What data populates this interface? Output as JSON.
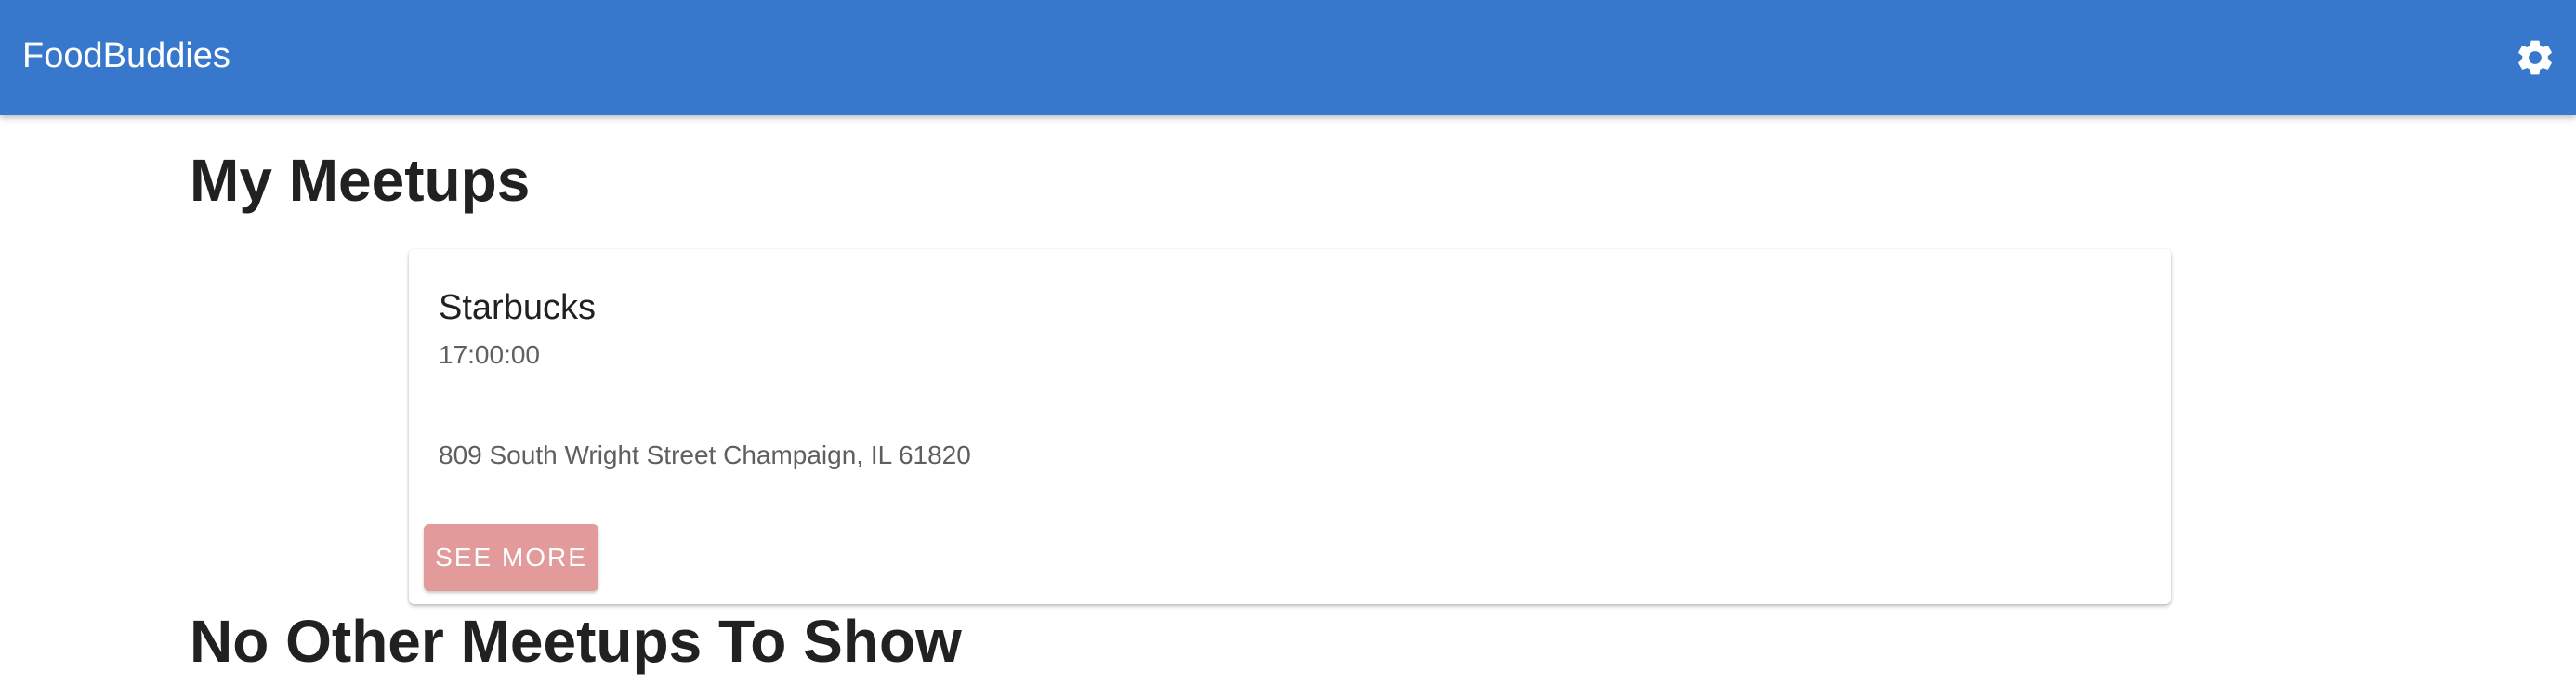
{
  "app": {
    "title": "FoodBuddies",
    "brand_color": "#3777cc",
    "settings_icon": "gear-icon"
  },
  "sections": {
    "my_meetups_title": "My Meetups",
    "other_meetups_title": "No Other Meetups To Show"
  },
  "meetups": [
    {
      "name": "Starbucks",
      "time": "17:00:00",
      "address": "809 South Wright Street Champaign, IL 61820",
      "button_label": "SEE MORE",
      "button_color": "#e39a9a"
    }
  ]
}
